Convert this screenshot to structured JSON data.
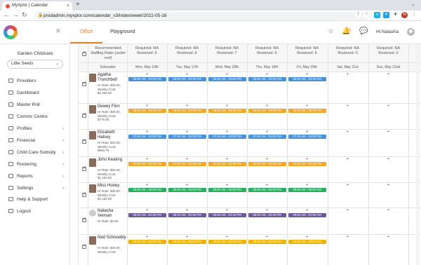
{
  "browser": {
    "tab_title": "MyXplor | Calendar",
    "tab_close": "×",
    "new_tab": "+",
    "url": "prodadmin.myxplor.com/calendar_v3/index/week/2022-05-16",
    "profile_letter": "N"
  },
  "header": {
    "tabs": [
      {
        "label": "Office"
      },
      {
        "label": "Playground"
      }
    ],
    "notification_count": "5",
    "greeting": "Hi Natasha"
  },
  "sidebar": {
    "center_name": "Garden Childcare",
    "center_select_value": "Little Seeds",
    "items": [
      {
        "label": "Providers"
      },
      {
        "label": "Dashboard"
      },
      {
        "label": "Master Roll"
      },
      {
        "label": "Comms Centre"
      },
      {
        "label": "Profiles"
      },
      {
        "label": "Financial"
      },
      {
        "label": "Child Care Subsidy"
      },
      {
        "label": "Rostering"
      },
      {
        "label": "Reports"
      },
      {
        "label": "Settings"
      },
      {
        "label": "Help & Support"
      },
      {
        "label": "Logout"
      }
    ]
  },
  "roster": {
    "ratio_label": "Recommended Staffing Ratio (under roof)",
    "educator_header": "Educator",
    "days": [
      {
        "label": "Mon, May 16th",
        "required": "Required: NA",
        "rostered": "Rostered: 6"
      },
      {
        "label": "Tue, May 17th",
        "required": "Required: NA",
        "rostered": "Rostered: 6"
      },
      {
        "label": "Wed, May 18th",
        "required": "Required: NA",
        "rostered": "Rostered: 7"
      },
      {
        "label": "Thu, May 19th",
        "required": "Required: NA",
        "rostered": "Rostered: 6"
      },
      {
        "label": "Fri, May 20th",
        "required": "Required: NA",
        "rostered": "Rostered: 6"
      },
      {
        "label": "Sat, May 21st",
        "required": "Required: NA",
        "rostered": "Rostered: 0"
      },
      {
        "label": "Sun, May 22nd",
        "required": "Required: NA",
        "rostered": "Rostered: 0"
      }
    ],
    "add_symbol": "+",
    "employees": [
      {
        "name": "Agatha Trunchbull",
        "meta": [
          "Hr Rate: $30.00 ,",
          "Weekly Cost:",
          "$1,162.50"
        ],
        "color": "#4a90d9",
        "shift": "06:00 AM - 03:00 PM",
        "days": 5
      },
      {
        "name": "Dewey Finn",
        "meta": [
          "Hr Rate: $20.00 ,",
          "Weekly Cost:",
          "$775.00"
        ],
        "color": "#f5a623",
        "shift": "06:30 AM - 03:30 PM",
        "days": 5
      },
      {
        "name": "Elizabeth Halsey",
        "meta": [
          "Hr Rate: $25.00 ,",
          "Weekly Cost:",
          "$968.75"
        ],
        "color": "#4a90d9",
        "shift": "07:00 AM - 04:00 PM",
        "days": 5
      },
      {
        "name": "John Keating",
        "meta": [
          "Hr Rate: $30.00 ,",
          "Weekly Cost:",
          "$1,162.50"
        ],
        "color": "#f5a623",
        "shift": "07:30 AM - 04:30 PM",
        "days": 5
      },
      {
        "name": "Miss Honey",
        "meta": [
          "Hr Rate: $30.00 ,",
          "Weekly Cost:",
          "$1,162.50"
        ],
        "color": "#27ae60",
        "shift": "08:00 AM - 05:00 PM",
        "days": 5
      },
      {
        "name": "Natasha Veiman",
        "meta": [
          "Hr Rate: $0.00"
        ],
        "color": "#6b5b95",
        "shift": "08:00 AM - 04:30 PM",
        "days": 5
      },
      {
        "name": "Ned Schneebly",
        "meta": [
          "Hr Rate: $30.00 ,",
          "Weekly Cost:"
        ],
        "color": "#f0b400",
        "shift": "09:00 AM - 06:00 PM",
        "days": 5
      }
    ]
  }
}
